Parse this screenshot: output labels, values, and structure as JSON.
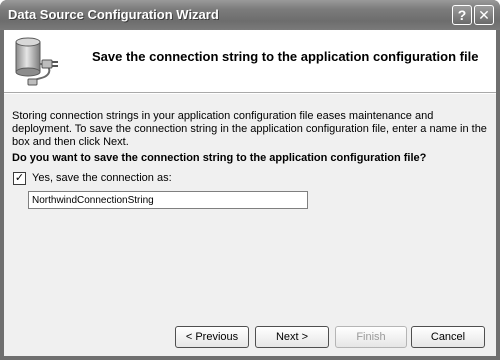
{
  "window": {
    "title": "Data Source Configuration Wizard",
    "help_label": "?",
    "close_label": "✕"
  },
  "header": {
    "title": "Save the connection string to the application configuration file",
    "icon": "database-connection-icon"
  },
  "body": {
    "description": "Storing connection strings in your application configuration file eases maintenance and deployment. To save the connection string in the application configuration file, enter a name in the box and then click Next.",
    "question": "Do you want to save the connection string to the application configuration file?",
    "checkbox": {
      "label": "Yes, save the connection as:",
      "checked": true,
      "mark": "✓"
    },
    "connection_name": "NorthwindConnectionString"
  },
  "buttons": {
    "previous": "< Previous",
    "next": "Next >",
    "finish": "Finish",
    "cancel": "Cancel"
  }
}
